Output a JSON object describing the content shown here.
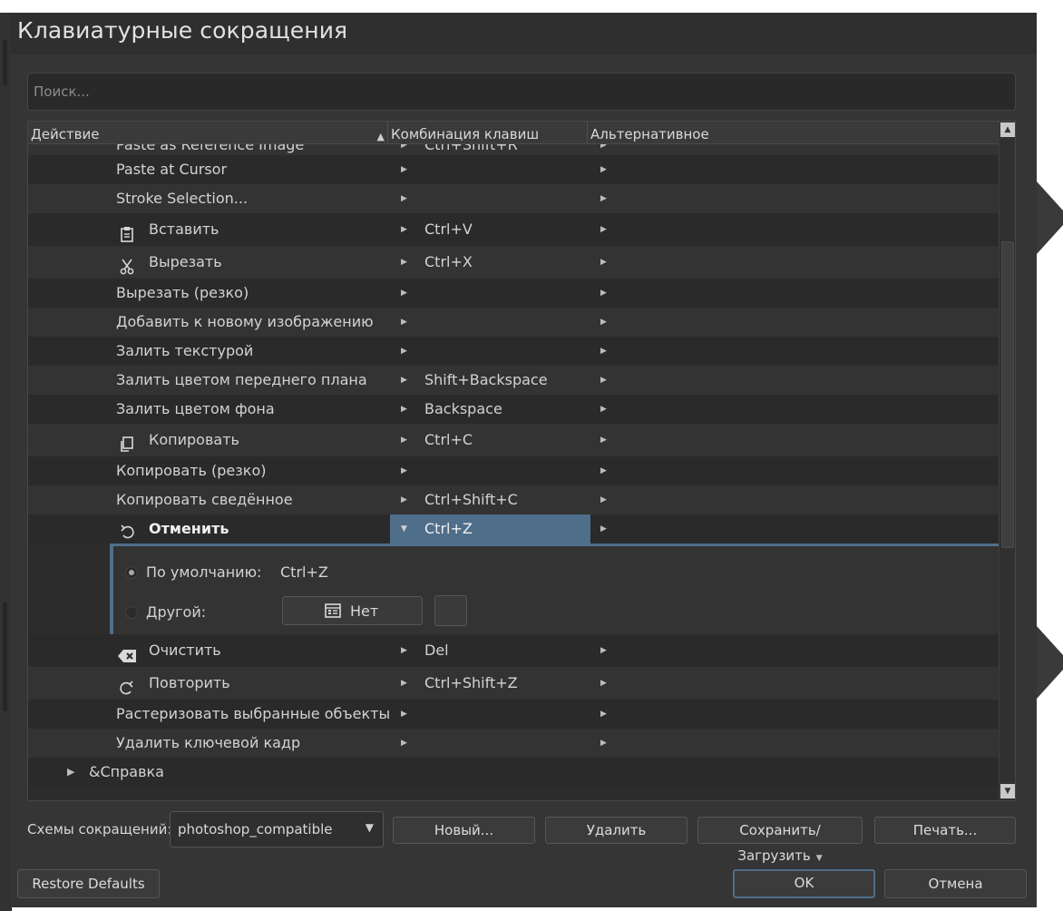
{
  "window": {
    "title": "Клавиатурные сокращения"
  },
  "search": {
    "placeholder": "Поиск..."
  },
  "table": {
    "columns": [
      "Действие",
      "Комбинация клавиш",
      "Альтернативное"
    ],
    "rows": [
      {
        "name": "Paste as Reference Image",
        "key": "Ctrl+Shift+R"
      },
      {
        "name": "Paste at Cursor",
        "key": ""
      },
      {
        "name": "Stroke Selection...",
        "key": ""
      },
      {
        "name": "Вставить",
        "key": "Ctrl+V",
        "icon": "paste-icon"
      },
      {
        "name": "Вырезать",
        "key": "Ctrl+X",
        "icon": "scissors-icon"
      },
      {
        "name": "Вырезать (резко)",
        "key": ""
      },
      {
        "name": "Добавить к новому изображению",
        "key": ""
      },
      {
        "name": "Залить текстурой",
        "key": ""
      },
      {
        "name": "Залить цветом переднего плана",
        "key": "Shift+Backspace"
      },
      {
        "name": "Залить цветом фона",
        "key": "Backspace"
      },
      {
        "name": "Копировать",
        "key": "Ctrl+C",
        "icon": "copy-icon"
      },
      {
        "name": "Копировать (резко)",
        "key": ""
      },
      {
        "name": "Копировать сведённое",
        "key": "Ctrl+Shift+C"
      },
      {
        "name": "Отменить",
        "key": "Ctrl+Z",
        "icon": "undo-icon",
        "selected": true
      },
      {
        "name": "Очистить",
        "key": "Del",
        "icon": "clear-icon"
      },
      {
        "name": "Повторить",
        "key": "Ctrl+Shift+Z",
        "icon": "redo-icon"
      },
      {
        "name": "Растеризовать выбранные объекты",
        "key": ""
      },
      {
        "name": "Удалить ключевой кадр",
        "key": ""
      }
    ],
    "group": {
      "label": "&Справка"
    }
  },
  "editor": {
    "default_label": "По умолчанию:",
    "default_value": "Ctrl+Z",
    "custom_label": "Другой:",
    "none_button": "Нет"
  },
  "footer": {
    "scheme_label": "Схемы сокращений:",
    "scheme_value": "photoshop_compatible",
    "new": "Новый...",
    "delete": "Удалить",
    "save_load": "Сохранить/Загрузить",
    "print": "Печать...",
    "restore": "Restore Defaults",
    "ok": "OK",
    "cancel": "Отмена"
  }
}
